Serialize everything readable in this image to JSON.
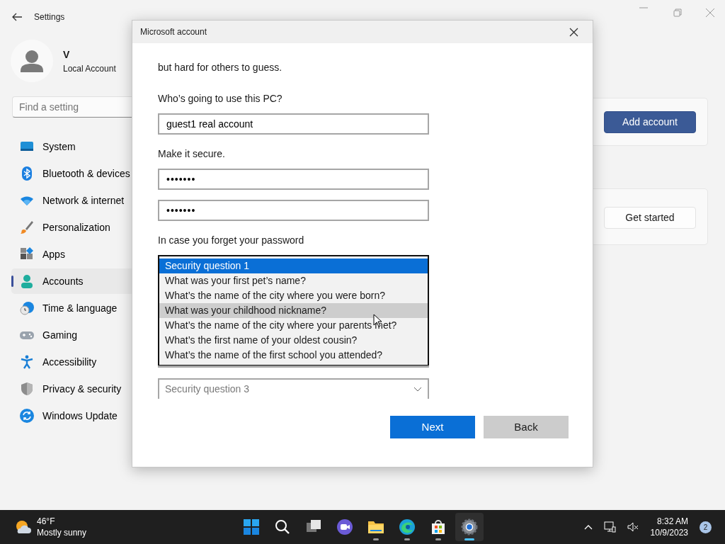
{
  "settings_window": {
    "title": "Settings",
    "user": {
      "name": "V",
      "account_type": "Local Account"
    },
    "search": {
      "placeholder": "Find a setting"
    },
    "nav_items": [
      {
        "label": "System",
        "selected": false
      },
      {
        "label": "Bluetooth & devices",
        "selected": false
      },
      {
        "label": "Network & internet",
        "selected": false
      },
      {
        "label": "Personalization",
        "selected": false
      },
      {
        "label": "Apps",
        "selected": false
      },
      {
        "label": "Accounts",
        "selected": true
      },
      {
        "label": "Time & language",
        "selected": false
      },
      {
        "label": "Gaming",
        "selected": false
      },
      {
        "label": "Accessibility",
        "selected": false
      },
      {
        "label": "Privacy & security",
        "selected": false
      },
      {
        "label": "Windows Update",
        "selected": false
      }
    ],
    "panel_buttons": [
      {
        "label": "Add account",
        "kind": "primary"
      },
      {
        "label": "Get started",
        "kind": "secondary"
      }
    ]
  },
  "dialog": {
    "title": "Microsoft account",
    "intro_tail": "but hard for others to guess.",
    "name_label": "Who’s going to use this PC?",
    "name_value": "guest1 real account",
    "secure_label": "Make it secure.",
    "password_fields": [
      {
        "value": "•••••••"
      },
      {
        "value": "•••••••"
      }
    ],
    "recovery_label": "In case you forget your password",
    "question_options": [
      {
        "label": "Security question 1",
        "selected": true,
        "hovered": false
      },
      {
        "label": "What was your first pet’s name?",
        "selected": false,
        "hovered": false
      },
      {
        "label": "What’s the name of the city where you were born?",
        "selected": false,
        "hovered": false
      },
      {
        "label": "What was your childhood nickname?",
        "selected": false,
        "hovered": true
      },
      {
        "label": "What’s the name of the city where your parents met?",
        "selected": false,
        "hovered": false
      },
      {
        "label": "What’s the first name of your oldest cousin?",
        "selected": false,
        "hovered": false
      },
      {
        "label": "What’s the name of the first school you attended?",
        "selected": false,
        "hovered": false
      }
    ],
    "question_3": {
      "placeholder": "Security question 3"
    },
    "buttons": [
      {
        "label": "Next",
        "kind": "primary"
      },
      {
        "label": "Back",
        "kind": "secondary"
      }
    ]
  },
  "taskbar": {
    "weather": {
      "temperature": "46°F",
      "condition": "Mostly sunny"
    },
    "apps": [
      {
        "kind": "start",
        "running": false,
        "active": false
      },
      {
        "kind": "search",
        "running": false,
        "active": false
      },
      {
        "kind": "taskview",
        "running": false,
        "active": false
      },
      {
        "kind": "chat",
        "running": false,
        "active": false
      },
      {
        "kind": "explorer",
        "running": true,
        "active": false
      },
      {
        "kind": "edge",
        "running": true,
        "active": false
      },
      {
        "kind": "store",
        "running": true,
        "active": false
      },
      {
        "kind": "settings",
        "running": true,
        "active": true
      }
    ],
    "time": "8:32 AM",
    "date": "10/9/2023",
    "notification_count": "2"
  }
}
